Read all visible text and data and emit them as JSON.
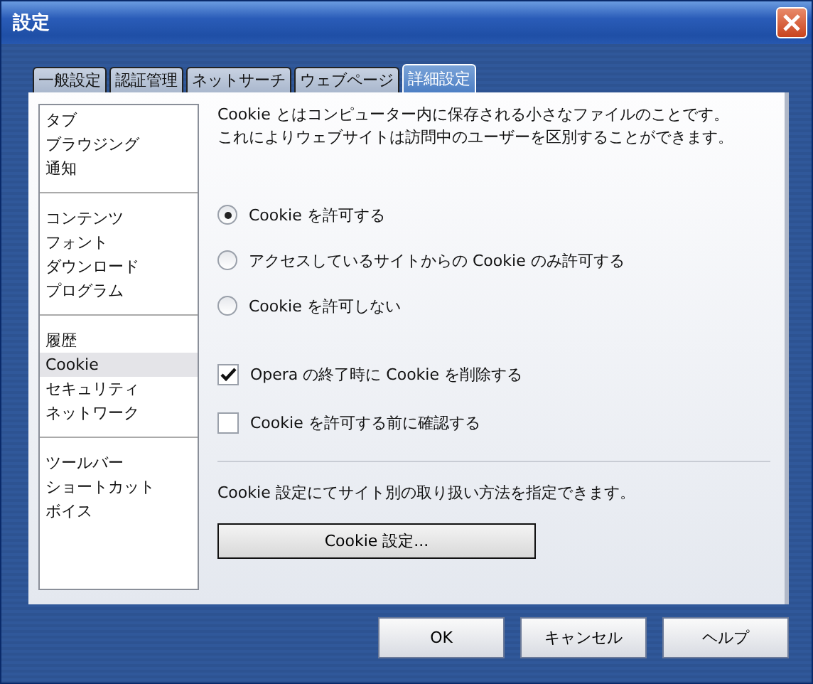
{
  "window": {
    "title": "設定"
  },
  "tabs": [
    {
      "label": "一般設定",
      "selected": false
    },
    {
      "label": "認証管理",
      "selected": false
    },
    {
      "label": "ネットサーチ",
      "selected": false
    },
    {
      "label": "ウェブページ",
      "selected": false
    },
    {
      "label": "詳細設定",
      "selected": true
    }
  ],
  "sidebar": {
    "groups": [
      {
        "items": [
          {
            "label": "タブ",
            "selected": false
          },
          {
            "label": "ブラウジング",
            "selected": false
          },
          {
            "label": "通知",
            "selected": false
          }
        ]
      },
      {
        "items": [
          {
            "label": "コンテンツ",
            "selected": false
          },
          {
            "label": "フォント",
            "selected": false
          },
          {
            "label": "ダウンロード",
            "selected": false
          },
          {
            "label": "プログラム",
            "selected": false
          }
        ]
      },
      {
        "items": [
          {
            "label": "履歴",
            "selected": false
          },
          {
            "label": "Cookie",
            "selected": true
          },
          {
            "label": "セキュリティ",
            "selected": false
          },
          {
            "label": "ネットワーク",
            "selected": false
          }
        ]
      },
      {
        "items": [
          {
            "label": "ツールバー",
            "selected": false
          },
          {
            "label": "ショートカット",
            "selected": false
          },
          {
            "label": "ボイス",
            "selected": false
          }
        ]
      }
    ]
  },
  "description": [
    "Cookie とはコンピューター内に保存される小さなファイルのことです。",
    "これによりウェブサイトは訪問中のユーザーを区別することができます。"
  ],
  "radio_options": [
    {
      "label": "Cookie を許可する",
      "selected": true
    },
    {
      "label": "アクセスしているサイトからの Cookie のみ許可する",
      "selected": false
    },
    {
      "label": "Cookie を許可しない",
      "selected": false
    }
  ],
  "checkboxes": [
    {
      "label": "Opera の終了時に Cookie を削除する",
      "checked": true
    },
    {
      "label": "Cookie を許可する前に確認する",
      "checked": false
    }
  ],
  "note": "Cookie 設定にてサイト別の取り扱い方法を指定できます。",
  "cookie_button": "Cookie 設定...",
  "buttons": [
    "OK",
    "キャンセル",
    "ヘルプ"
  ]
}
